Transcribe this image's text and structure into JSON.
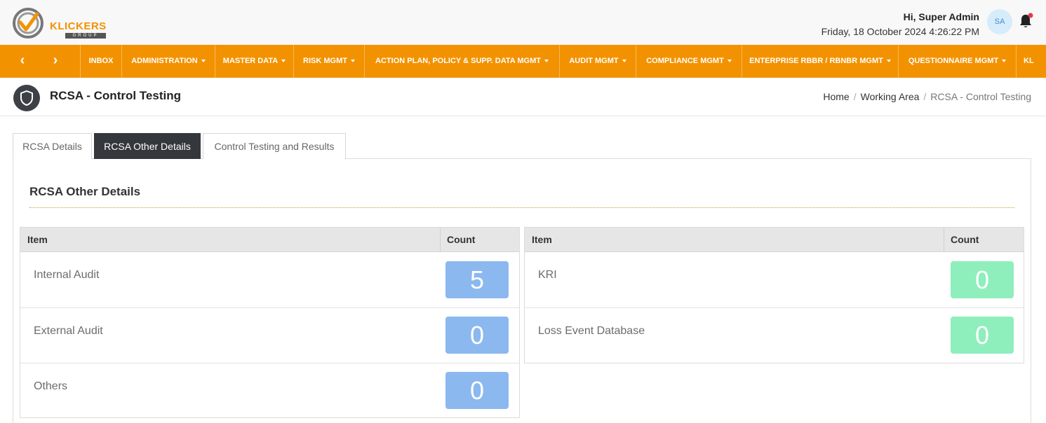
{
  "brand": {
    "logo_text": "KLICKERS",
    "logo_subtext": "GROUP",
    "accent_color": "#f39200"
  },
  "header": {
    "greeting": "Hi, Super Admin",
    "datetime": "Friday, 18 October 2024 4:26:22 PM",
    "avatar_initials": "SA",
    "notification_icon": "bell-icon"
  },
  "nav": {
    "prev_label": "‹",
    "next_label": "›",
    "items": [
      {
        "label": "INBOX",
        "has_dropdown": false
      },
      {
        "label": "ADMINISTRATION",
        "has_dropdown": true
      },
      {
        "label": "MASTER DATA",
        "has_dropdown": true
      },
      {
        "label": "RISK MGMT",
        "has_dropdown": true
      },
      {
        "label": "ACTION PLAN, POLICY & SUPP. DATA MGMT",
        "has_dropdown": true
      },
      {
        "label": "AUDIT MGMT",
        "has_dropdown": true
      },
      {
        "label": "COMPLIANCE MGMT",
        "has_dropdown": true
      },
      {
        "label": "ENTERPRISE RBBR / RBNBR MGMT",
        "has_dropdown": true
      },
      {
        "label": "QUESTIONNAIRE MGMT",
        "has_dropdown": true
      },
      {
        "label": "KL",
        "has_dropdown": false
      }
    ]
  },
  "page": {
    "title": "RCSA - Control Testing",
    "icon": "shield-icon",
    "breadcrumb": [
      "Home",
      "Working Area",
      "RCSA - Control Testing"
    ]
  },
  "tabs": [
    {
      "label": "RCSA Details",
      "active": false
    },
    {
      "label": "RCSA Other Details",
      "active": true
    },
    {
      "label": "Control Testing and Results",
      "active": false
    }
  ],
  "section": {
    "title": "RCSA Other Details"
  },
  "tables": [
    {
      "headers": {
        "item": "Item",
        "count": "Count"
      },
      "count_color": "#8bb8ef",
      "rows": [
        {
          "item": "Internal Audit",
          "count": "5"
        },
        {
          "item": "External Audit",
          "count": "0"
        },
        {
          "item": "Others",
          "count": "0"
        }
      ]
    },
    {
      "headers": {
        "item": "Item",
        "count": "Count"
      },
      "count_color": "#8eefbc",
      "rows": [
        {
          "item": "KRI",
          "count": "0"
        },
        {
          "item": "Loss Event Database",
          "count": "0"
        }
      ]
    }
  ]
}
